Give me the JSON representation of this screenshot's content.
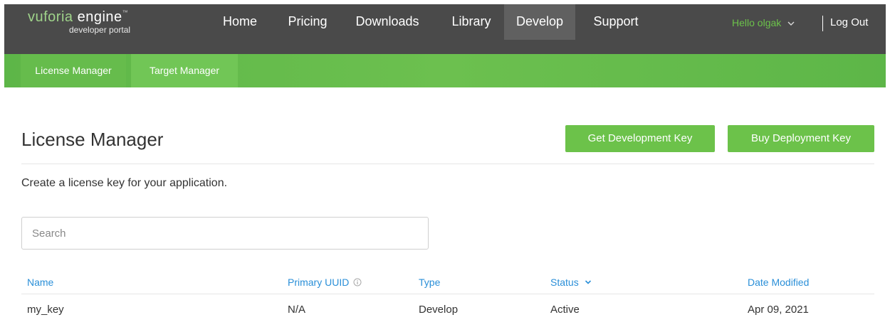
{
  "header": {
    "logo_main": "vuforia",
    "logo_engine": "engine",
    "logo_tm": "™",
    "logo_sub": "developer portal",
    "nav": [
      {
        "label": "Home"
      },
      {
        "label": "Pricing"
      },
      {
        "label": "Downloads"
      },
      {
        "label": "Library"
      },
      {
        "label": "Develop",
        "active": true
      },
      {
        "label": "Support"
      }
    ],
    "user_greeting": "Hello olgak",
    "logout_label": "Log Out"
  },
  "subnav": {
    "tabs": [
      {
        "label": "License Manager",
        "active": true
      },
      {
        "label": "Target Manager"
      }
    ]
  },
  "main": {
    "title": "License Manager",
    "get_dev_key_label": "Get Development Key",
    "buy_deploy_key_label": "Buy Deployment Key",
    "description": "Create a license key for your application.",
    "search_placeholder": "Search"
  },
  "table": {
    "columns": [
      "Name",
      "Primary UUID",
      "Type",
      "Status",
      "Date Modified"
    ],
    "rows": [
      {
        "name": "my_key",
        "uuid": "N/A",
        "type": "Develop",
        "status": "Active",
        "date": "Apr 09, 2021"
      }
    ]
  },
  "colors": {
    "header_bg": "#4a4a4a",
    "brand_green": "#6cc24a",
    "link_blue": "#2a8fd8"
  }
}
